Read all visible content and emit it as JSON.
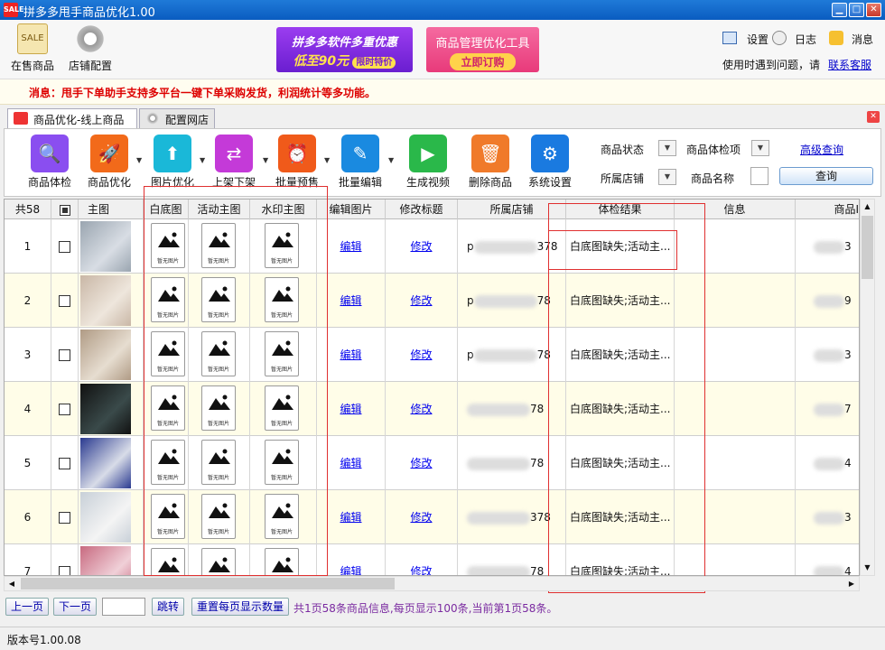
{
  "window": {
    "title": "拼多多甩手商品优化1.00",
    "logo_text": "SALE"
  },
  "toolbar": {
    "on_sale_label": "在售商品",
    "shop_config_label": "店铺配置",
    "sale_tag": "SALE",
    "promo1": {
      "line1": "拼多多软件多重优惠",
      "line2": "低至90元",
      "badge": "限时特价"
    },
    "promo2": {
      "line1": "商品管理优化工具",
      "badge": "立即订购"
    },
    "settings_label": "设置",
    "log_label": "日志",
    "message_label": "消息",
    "help_text": "使用时遇到问题，请",
    "contact_label": "联系客服"
  },
  "message": {
    "prefix": "消息：",
    "text": "甩手下单助手支持多平台一键下单采购发货，利润统计等多功能。"
  },
  "tabs": [
    {
      "label": "商品优化-线上商品"
    },
    {
      "label": "配置网店"
    }
  ],
  "actions": [
    {
      "label": "商品体检"
    },
    {
      "label": "商品优化"
    },
    {
      "label": "图片优化"
    },
    {
      "label": "上架下架"
    },
    {
      "label": "批量预售"
    },
    {
      "label": "批量编辑"
    },
    {
      "label": "生成视频"
    },
    {
      "label": "删除商品"
    },
    {
      "label": "系统设置"
    }
  ],
  "filters": {
    "status_label": "商品状态",
    "check_label": "商品体检项",
    "advanced_label": "高级查询",
    "shop_label": "所属店铺",
    "name_label": "商品名称",
    "query_label": "查询"
  },
  "grid": {
    "headers": [
      "共58",
      "",
      "主图",
      "白底图",
      "活动主图",
      "水印主图",
      "编辑图片",
      "修改标题",
      "所属店铺",
      "体检结果",
      "信息",
      "商品I"
    ],
    "no_image_text": "暂无图片",
    "edit_label": "编辑",
    "modify_label": "修改",
    "rows": [
      {
        "num": "1",
        "shop_suffix": "378",
        "shop_prefix": "p",
        "result": "白底图缺失;活动主...",
        "id_suffix": "3"
      },
      {
        "num": "2",
        "shop_suffix": "78",
        "shop_prefix": "p",
        "result": "白底图缺失;活动主...",
        "id_suffix": "9"
      },
      {
        "num": "3",
        "shop_suffix": "78",
        "shop_prefix": "p",
        "result": "白底图缺失;活动主...",
        "id_suffix": "3"
      },
      {
        "num": "4",
        "shop_suffix": "78",
        "shop_prefix": "",
        "result": "白底图缺失;活动主...",
        "id_suffix": "7"
      },
      {
        "num": "5",
        "shop_suffix": "78",
        "shop_prefix": "",
        "result": "白底图缺失;活动主...",
        "id_suffix": "4"
      },
      {
        "num": "6",
        "shop_suffix": "378",
        "shop_prefix": "",
        "result": "白底图缺失;活动主...",
        "id_suffix": "3"
      },
      {
        "num": "7",
        "shop_suffix": "78",
        "shop_prefix": "",
        "result": "白底图缺失;活动主...",
        "id_suffix": "4"
      }
    ]
  },
  "pager": {
    "prev_label": "上一页",
    "next_label": "下一页",
    "page_input": "",
    "jump_label": "跳转",
    "reset_label": "重置每页显示数量",
    "info": "共1页58条商品信息,每页显示100条,当前第1页58条。"
  },
  "status": {
    "version": "版本号1.00.08"
  },
  "colors": {
    "title_bar": "#0a5cc0",
    "message_red": "#dd0000",
    "highlight_red": "#e03030",
    "alt_row": "#fffde8"
  }
}
